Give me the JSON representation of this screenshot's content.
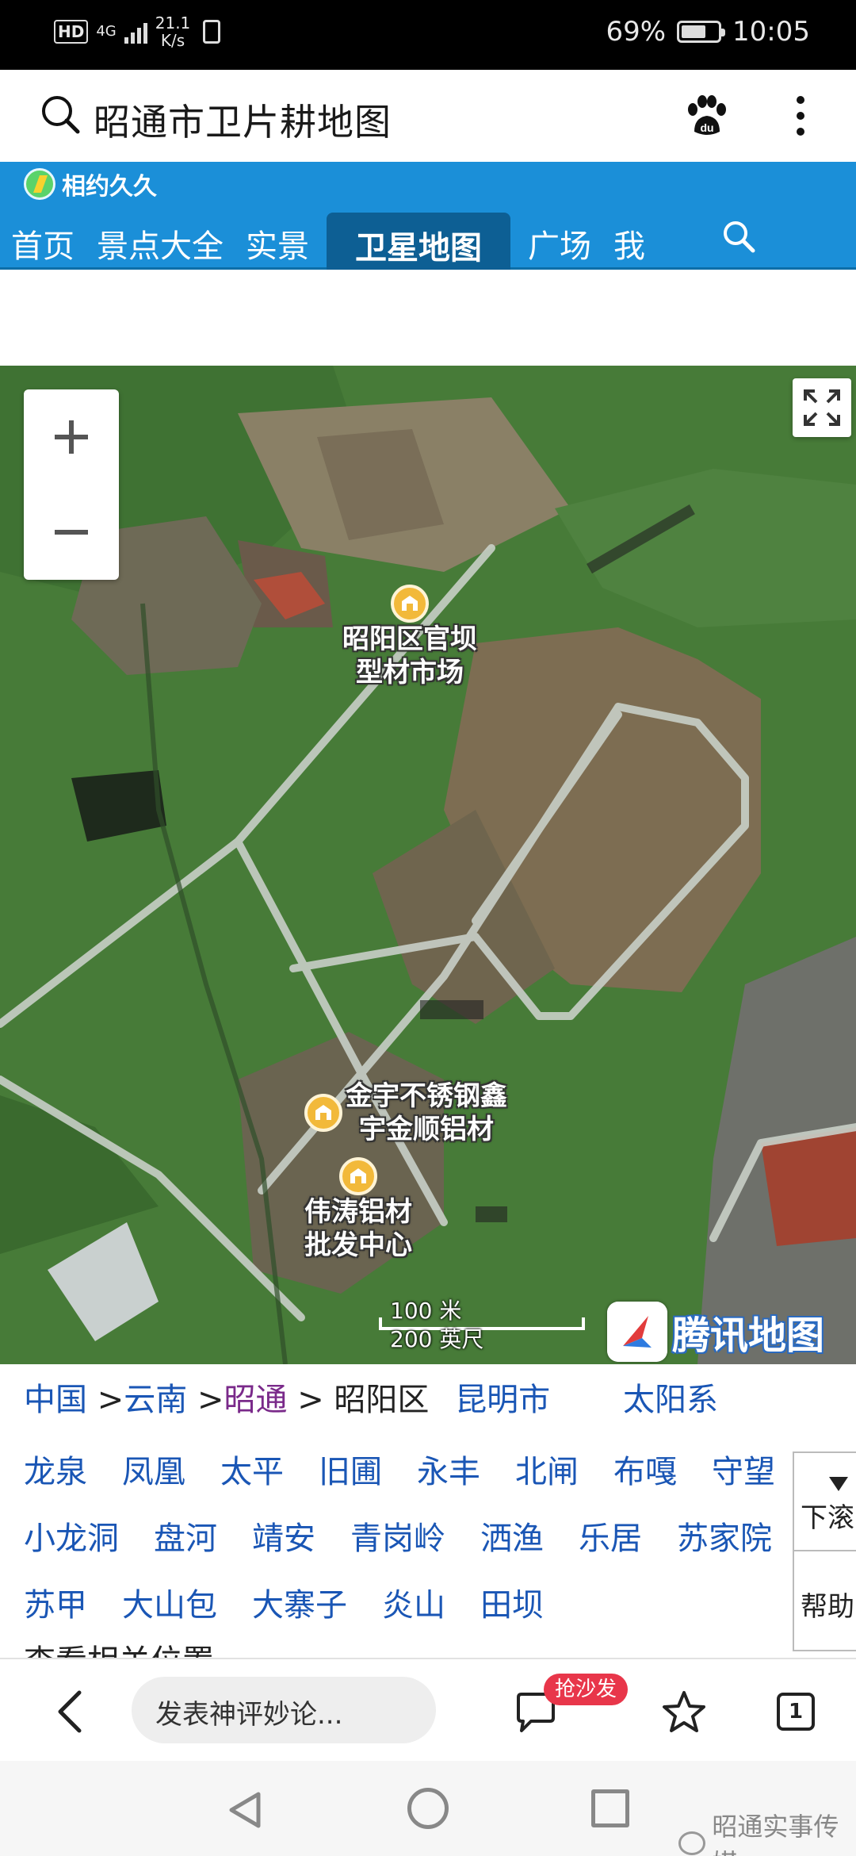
{
  "status_bar": {
    "hd": "HD",
    "signal_type": "4G",
    "net_speed_value": "21.1",
    "net_speed_unit": "K/s",
    "battery": "69%",
    "battery_level": 0.69,
    "time": "10:05"
  },
  "search": {
    "query": "昭通市卫片耕地图"
  },
  "site": {
    "logo_text": "相约久久",
    "nav": [
      "首页",
      "景点大全",
      "实景",
      "卫星地图",
      "广场",
      "我"
    ],
    "active_nav": "卫星地图"
  },
  "map": {
    "zoom_in": "+",
    "zoom_out": "−",
    "pois": [
      {
        "name_line1": "昭阳区官坝",
        "name_line2": "型材市场"
      },
      {
        "name_line1": "金宇不锈钢鑫",
        "name_line2": "宇金顺铝材"
      },
      {
        "name_line1": "伟涛铝材",
        "name_line2": "批发中心"
      }
    ],
    "scale_metric": "100 米",
    "scale_imperial": "200 英尺",
    "provider": "腾讯地图"
  },
  "breadcrumb": {
    "items": [
      "中国",
      "云南",
      "昭通",
      "昭阳区"
    ],
    "separator": ">",
    "extra_link": "昆明市",
    "solar": "太阳系"
  },
  "links": {
    "rows": [
      [
        "龙泉",
        "凤凰",
        "太平",
        "旧圃",
        "永丰",
        "北闸",
        "布嘎",
        "守望"
      ],
      [
        "小龙洞",
        "盘河",
        "靖安",
        "青岗岭",
        "洒渔",
        "乐居",
        "苏家院"
      ],
      [
        "苏甲",
        "大山包",
        "大寨子",
        "炎山",
        "田坝"
      ]
    ],
    "cutoff_text": "查看相关位置"
  },
  "side_panel": {
    "scroll_down": "下滚",
    "help": "帮助"
  },
  "toolbar": {
    "comment_placeholder": "发表神评妙论...",
    "sofa_badge": "抢沙发",
    "tab_count": "1"
  },
  "watermark": "昭通实事传媒",
  "colors": {
    "header_blue": "#1b8fd8",
    "active_tab": "#0d5f94",
    "link_blue": "#1a56b5",
    "badge_red": "#e8364a"
  }
}
